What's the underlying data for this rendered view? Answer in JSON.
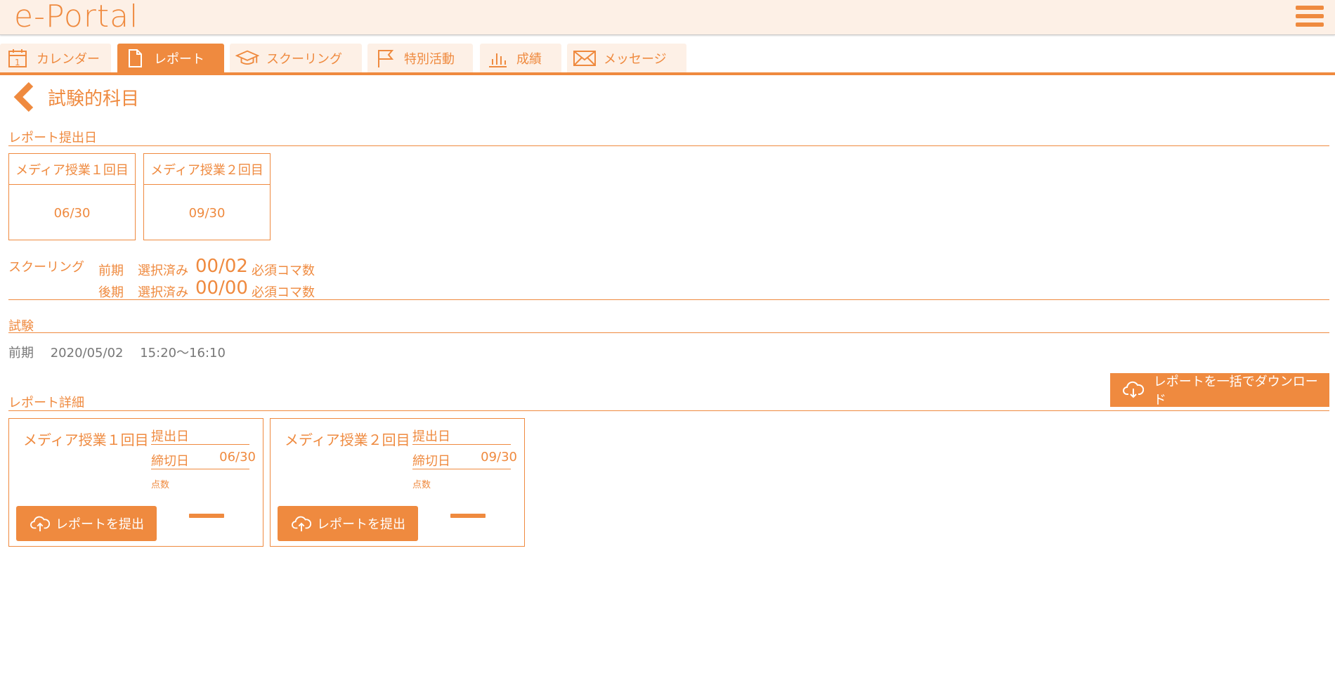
{
  "app": {
    "logo": "e-Portal"
  },
  "tabs": [
    {
      "label": "カレンダー",
      "icon": "calendar-icon",
      "active": false
    },
    {
      "label": "レポート",
      "icon": "document-icon",
      "active": true
    },
    {
      "label": "スクーリング",
      "icon": "graduation-cap-icon",
      "active": false
    },
    {
      "label": "特別活動",
      "icon": "flag-icon",
      "active": false
    },
    {
      "label": "成績",
      "icon": "bar-chart-icon",
      "active": false
    },
    {
      "label": "メッセージ",
      "icon": "envelope-icon",
      "active": false
    }
  ],
  "page": {
    "title": "試験的科目"
  },
  "report_dates": {
    "label": "レポート提出日",
    "items": [
      {
        "name": "メディア授業１回目",
        "date": "06/30"
      },
      {
        "name": "メディア授業２回目",
        "date": "09/30"
      }
    ]
  },
  "schooling": {
    "label": "スクーリング",
    "rows": [
      {
        "term": "前期",
        "selected_label": "選択済み",
        "count": "00/02",
        "required_label": "必須コマ数"
      },
      {
        "term": "後期",
        "selected_label": "選択済み",
        "count": "00/00",
        "required_label": "必須コマ数"
      }
    ]
  },
  "exam": {
    "label": "試験",
    "term": "前期",
    "date": "2020/05/02",
    "time": "15:20〜16:10"
  },
  "report_detail": {
    "label": "レポート詳細",
    "download_label": "レポートを一括でダウンロード",
    "cards": [
      {
        "title": "メディア授業１回目",
        "submitted_label": "提出日",
        "deadline_label": "締切日",
        "deadline": "06/30",
        "score_label": "点数",
        "submit_label": "レポートを提出"
      },
      {
        "title": "メディア授業２回目",
        "submitted_label": "提出日",
        "deadline_label": "締切日",
        "deadline": "09/30",
        "score_label": "点数",
        "submit_label": "レポートを提出"
      }
    ]
  },
  "colors": {
    "accent": "#ef8a3f",
    "header_bg": "#fdf0e6",
    "muted_text": "#777777"
  }
}
